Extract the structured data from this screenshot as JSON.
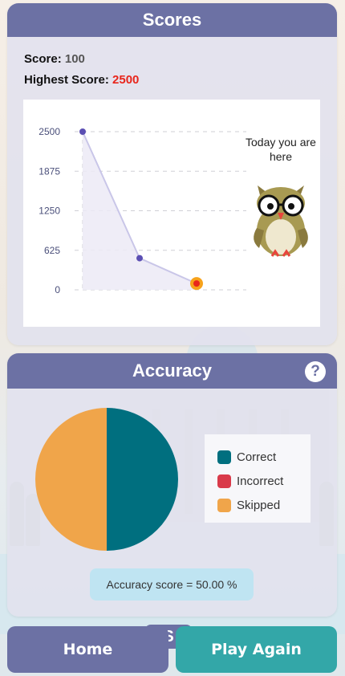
{
  "scores": {
    "title": "Scores",
    "score_label": "Score:",
    "score_value": "100",
    "highest_label": "Highest Score:",
    "highest_value": "2500",
    "today_text": "Today you are here"
  },
  "chart_data": {
    "type": "area",
    "x": [
      1,
      2,
      3
    ],
    "y": [
      2500,
      500,
      100
    ],
    "yticks": [
      "2500",
      "1875",
      "1250",
      "625",
      "0"
    ],
    "ylim": [
      0,
      2500
    ],
    "grid": true,
    "highlight_last_point": true,
    "colors": {
      "line": "#c9c6e8",
      "fill": "#eceaf6",
      "point": "#5b4fb3",
      "current": "#e8261c",
      "current_ring": "#f7a21b"
    }
  },
  "accuracy": {
    "title": "Accuracy",
    "help_icon": "?",
    "legend": [
      {
        "label": "Correct",
        "color": "#006f7f"
      },
      {
        "label": "Incorrect",
        "color": "#d93a4a"
      },
      {
        "label": "Skipped",
        "color": "#f0a54a"
      }
    ],
    "pie": [
      {
        "label": "Correct",
        "value": 50,
        "color": "#006f7f"
      },
      {
        "label": "Incorrect",
        "value": 0,
        "color": "#d93a4a"
      },
      {
        "label": "Skipped",
        "value": 50,
        "color": "#f0a54a"
      }
    ],
    "score_text": "Accuracy score = 50.00 %"
  },
  "footer": {
    "hidden_peek": "S",
    "home_label": "Home",
    "play_again_label": "Play Again"
  },
  "colors": {
    "header": "#6c71a4",
    "play": "#33a7a8"
  }
}
